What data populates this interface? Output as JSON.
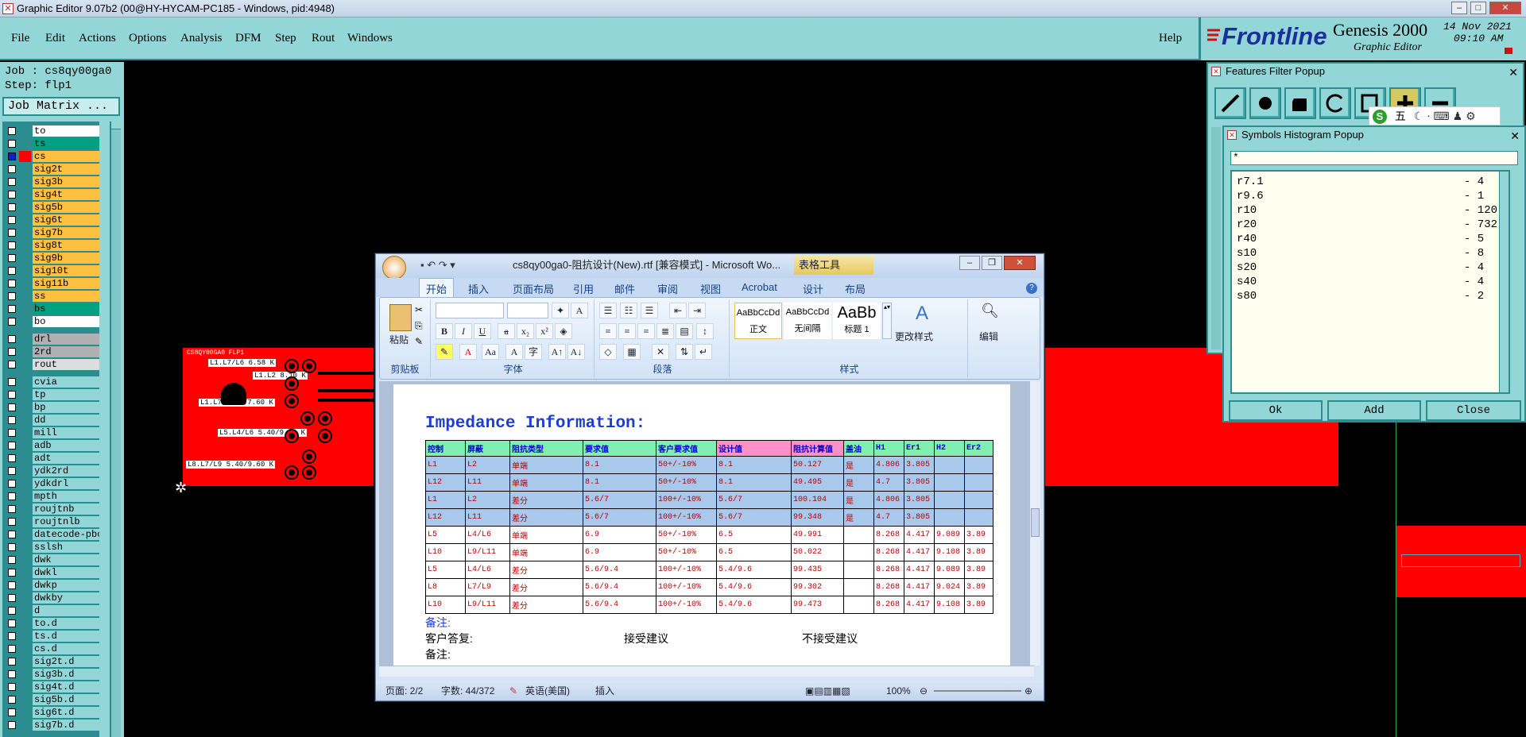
{
  "app": {
    "window_title": "Graphic Editor 9.07b2 (00@HY-HYCAM-PC185 - Windows, pid:4948)",
    "menu": [
      "File",
      "Edit",
      "Actions",
      "Options",
      "Analysis",
      "DFM",
      "Step",
      "Rout",
      "Windows"
    ],
    "help": "Help",
    "brand": "Frontline",
    "product": "Genesis 2000",
    "subtitle": "Graphic Editor",
    "date": "14 Nov 2021",
    "time": "09:10 AM"
  },
  "left": {
    "job": "Job : cs8qy00ga0",
    "step": "Step: flp1",
    "matrix_button": "Job Matrix ...",
    "layers": [
      {
        "name": "to",
        "color": "#ffffff"
      },
      {
        "name": "ts",
        "color": "#00a080"
      },
      {
        "name": "cs",
        "color": "#ffc040",
        "selected": true
      },
      {
        "name": "sig2t",
        "color": "#ffc040"
      },
      {
        "name": "sig3b",
        "color": "#ffc040"
      },
      {
        "name": "sig4t",
        "color": "#ffc040"
      },
      {
        "name": "sig5b",
        "color": "#ffc040"
      },
      {
        "name": "sig6t",
        "color": "#ffc040"
      },
      {
        "name": "sig7b",
        "color": "#ffc040"
      },
      {
        "name": "sig8t",
        "color": "#ffc040"
      },
      {
        "name": "sig9b",
        "color": "#ffc040"
      },
      {
        "name": "sig10t",
        "color": "#ffc040"
      },
      {
        "name": "sig11b",
        "color": "#ffc040"
      },
      {
        "name": "ss",
        "color": "#ffc040"
      },
      {
        "name": "bs",
        "color": "#00a080"
      },
      {
        "name": "bo",
        "color": "#ffffff"
      },
      {
        "name": "drl",
        "color": "#b0b0b0",
        "gap": true
      },
      {
        "name": "2rd",
        "color": "#b0b0b0"
      },
      {
        "name": "rout",
        "color": "#dddddd"
      },
      {
        "name": "cvia",
        "color": "#93d6d8",
        "gap": true
      },
      {
        "name": "tp",
        "color": "#93d6d8"
      },
      {
        "name": "bp",
        "color": "#93d6d8"
      },
      {
        "name": "dd",
        "color": "#93d6d8"
      },
      {
        "name": "mill",
        "color": "#93d6d8"
      },
      {
        "name": "adb",
        "color": "#93d6d8"
      },
      {
        "name": "adt",
        "color": "#93d6d8"
      },
      {
        "name": "ydk2rd",
        "color": "#93d6d8"
      },
      {
        "name": "ydkdrl",
        "color": "#93d6d8"
      },
      {
        "name": "mpth",
        "color": "#93d6d8"
      },
      {
        "name": "roujtnb",
        "color": "#93d6d8"
      },
      {
        "name": "roujtnlb",
        "color": "#93d6d8"
      },
      {
        "name": "datecode-pbo",
        "color": "#93d6d8"
      },
      {
        "name": "sslsh",
        "color": "#93d6d8"
      },
      {
        "name": "dwk",
        "color": "#93d6d8"
      },
      {
        "name": "dwkl",
        "color": "#93d6d8"
      },
      {
        "name": "dwkp",
        "color": "#93d6d8"
      },
      {
        "name": "dwkby",
        "color": "#93d6d8"
      },
      {
        "name": "d",
        "color": "#93d6d8"
      },
      {
        "name": "to.d",
        "color": "#93d6d8"
      },
      {
        "name": "ts.d",
        "color": "#93d6d8"
      },
      {
        "name": "cs.d",
        "color": "#93d6d8"
      },
      {
        "name": "sig2t.d",
        "color": "#93d6d8"
      },
      {
        "name": "sig3b.d",
        "color": "#93d6d8"
      },
      {
        "name": "sig4t.d",
        "color": "#93d6d8"
      },
      {
        "name": "sig5b.d",
        "color": "#93d6d8"
      },
      {
        "name": "sig6t.d",
        "color": "#93d6d8"
      },
      {
        "name": "sig7b.d",
        "color": "#93d6d8"
      }
    ]
  },
  "pcb_labels": [
    "CS8QY00GA0 FLP1",
    "L1.L7/L6 6.58 K",
    "L1.L2 8.10 K",
    "L1.L7 5.66/7.60 K",
    "L5.L4/L6 5.40/9.60 K",
    "L8.L7/L9 5.40/9.60 K"
  ],
  "features_popup": {
    "title": "Features Filter Popup"
  },
  "symbols_popup": {
    "title": "Symbols Histogram Popup",
    "filter": "*",
    "rows": [
      {
        "sym": "r7.1",
        "count": "- 4"
      },
      {
        "sym": "r9.6",
        "count": "- 1"
      },
      {
        "sym": "r10",
        "count": "- 120"
      },
      {
        "sym": "r20",
        "count": "- 732"
      },
      {
        "sym": "r40",
        "count": "- 5"
      },
      {
        "sym": "s10",
        "count": "- 8"
      },
      {
        "sym": "s20",
        "count": "- 4"
      },
      {
        "sym": "s40",
        "count": "- 4"
      },
      {
        "sym": "s80",
        "count": "- 2"
      }
    ],
    "ok": "Ok",
    "add": "Add",
    "close": "Close"
  },
  "ime": {
    "label": "五"
  },
  "word": {
    "title": "cs8qy00ga0-阻抗设计(New).rtf [兼容模式] - Microsoft Wo...",
    "table_tools": "表格工具",
    "tabs": [
      "开始",
      "插入",
      "页面布局",
      "引用",
      "邮件",
      "审阅",
      "视图",
      "Acrobat",
      "设计",
      "布局"
    ],
    "groups": {
      "clipboard": "剪贴板",
      "font": "字体",
      "paragraph": "段落",
      "styles": "样式"
    },
    "paste": "粘贴",
    "styles": [
      {
        "sample": "AaBbCcDd",
        "name": "正文"
      },
      {
        "sample": "AaBbCcDd",
        "name": "无间隔"
      },
      {
        "sample": "AaBb",
        "name": "标题 1"
      }
    ],
    "change_styles": "更改样式",
    "edit": "编辑",
    "heading": "Impedance Information:",
    "table_headers": [
      "控制",
      "屏蔽",
      "阻抗类型",
      "要求值",
      "客户要求值",
      "设计值",
      "阻抗计算值",
      "盖油",
      "H1",
      "Er1",
      "H2",
      "Er2"
    ],
    "table_rows": [
      [
        "L1",
        "L2",
        "单端",
        "8.1",
        "50+/-10%",
        "8.1",
        "50.127",
        "是",
        "4.806",
        "3.805",
        "",
        ""
      ],
      [
        "L12",
        "L11",
        "单端",
        "8.1",
        "50+/-10%",
        "8.1",
        "49.495",
        "是",
        "4.7",
        "3.805",
        "",
        ""
      ],
      [
        "L1",
        "L2",
        "差分",
        "5.6/7",
        "100+/-10%",
        "5.6/7",
        "100.104",
        "是",
        "4.806",
        "3.805",
        "",
        ""
      ],
      [
        "L12",
        "L11",
        "差分",
        "5.6/7",
        "100+/-10%",
        "5.6/7",
        "99.348",
        "是",
        "4.7",
        "3.805",
        "",
        ""
      ],
      [
        "L5",
        "L4/L6",
        "单端",
        "6.9",
        "50+/-10%",
        "6.5",
        "49.991",
        "",
        "8.268",
        "4.417",
        "9.089",
        "3.89"
      ],
      [
        "L10",
        "L9/L11",
        "单端",
        "6.9",
        "50+/-10%",
        "6.5",
        "50.022",
        "",
        "8.268",
        "4.417",
        "9.108",
        "3.89"
      ],
      [
        "L5",
        "L4/L6",
        "差分",
        "5.6/9.4",
        "100+/-10%",
        "5.4/9.6",
        "99.435",
        "",
        "8.268",
        "4.417",
        "9.089",
        "3.89"
      ],
      [
        "L8",
        "L7/L9",
        "差分",
        "5.6/9.4",
        "100+/-10%",
        "5.4/9.6",
        "99.302",
        "",
        "8.268",
        "4.417",
        "9.024",
        "3.89"
      ],
      [
        "L10",
        "L9/L11",
        "差分",
        "5.6/9.4",
        "100+/-10%",
        "5.4/9.6",
        "99.473",
        "",
        "8.268",
        "4.417",
        "9.108",
        "3.89"
      ]
    ],
    "note1": "备注:",
    "reply": "客户答复:",
    "accept": "接受建议",
    "reject": "不接受建议",
    "note2": "备注:",
    "status": {
      "page": "页面: 2/2",
      "words": "字数: 44/372",
      "lang": "英语(美国)",
      "mode": "插入",
      "zoom": "100%"
    }
  },
  "colors": {
    "teal": "#93d6d8",
    "dark_teal": "#2b8d90",
    "copper": "#ff0000"
  }
}
